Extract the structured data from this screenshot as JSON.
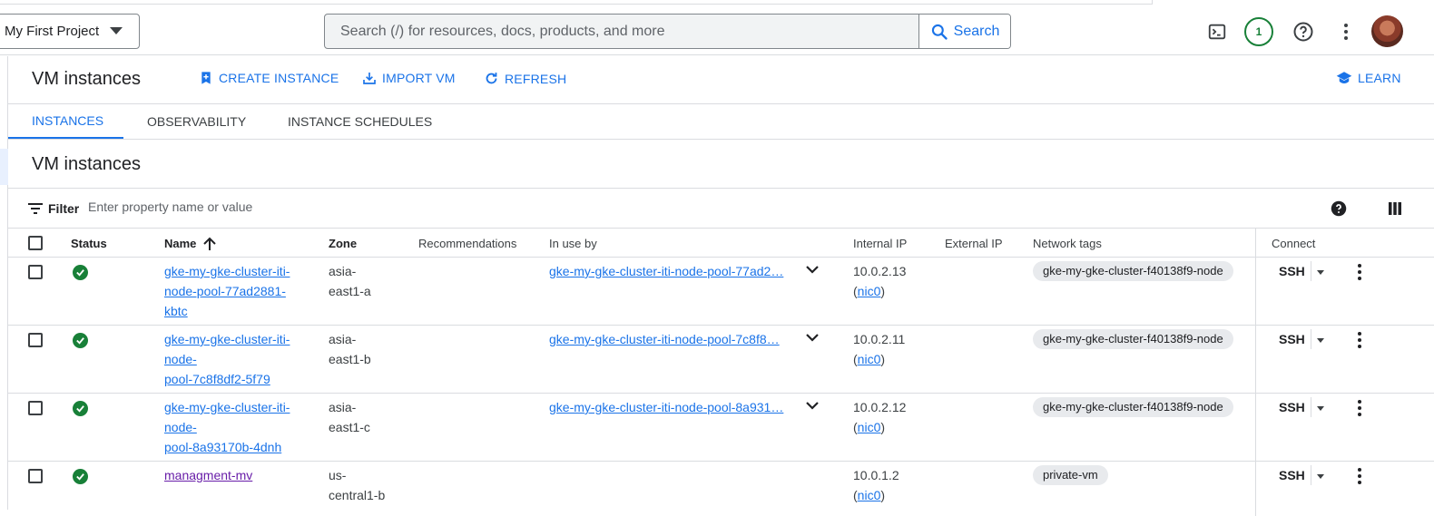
{
  "header": {
    "project": "My First Project",
    "search_placeholder": "Search (/) for resources, docs, products, and more",
    "search_button": "Search",
    "notification_count": "1",
    "icons": [
      "cloud-shell-icon",
      "notification-badge",
      "help-icon",
      "more-vert-icon",
      "avatar"
    ]
  },
  "toolbar": {
    "title": "VM instances",
    "create": "CREATE INSTANCE",
    "import": "IMPORT VM",
    "refresh": "REFRESH",
    "learn": "LEARN"
  },
  "tabs": [
    {
      "label": "INSTANCES",
      "active": true
    },
    {
      "label": "OBSERVABILITY",
      "active": false
    },
    {
      "label": "INSTANCE SCHEDULES",
      "active": false
    }
  ],
  "section_title": "VM instances",
  "filter": {
    "label": "Filter",
    "placeholder": "Enter property name or value"
  },
  "columns": {
    "status": "Status",
    "name": "Name",
    "zone": "Zone",
    "recommendations": "Recommendations",
    "in_use_by": "In use by",
    "internal_ip": "Internal IP",
    "external_ip": "External IP",
    "network_tags": "Network tags",
    "connect": "Connect"
  },
  "rows": [
    {
      "name_lines": [
        "gke-my-gke-cluster-iti-",
        "node-pool-77ad2881-",
        "kbtc"
      ],
      "zone_lines": [
        "asia-",
        "east1-a"
      ],
      "in_use_by": "gke-my-gke-cluster-iti-node-pool-77ad2…",
      "internal_ip": "10.0.2.13",
      "nic": "nic0",
      "tag": "gke-my-gke-cluster-f40138f9-node",
      "connect": "SSH",
      "status": "running"
    },
    {
      "name_lines": [
        "gke-my-gke-cluster-iti-",
        "node-",
        "pool-7c8f8df2-5f79"
      ],
      "zone_lines": [
        "asia-",
        "east1-b"
      ],
      "in_use_by": "gke-my-gke-cluster-iti-node-pool-7c8f8…",
      "internal_ip": "10.0.2.11",
      "nic": "nic0",
      "tag": "gke-my-gke-cluster-f40138f9-node",
      "connect": "SSH",
      "status": "running"
    },
    {
      "name_lines": [
        "gke-my-gke-cluster-iti-",
        "node-",
        "pool-8a93170b-4dnh"
      ],
      "zone_lines": [
        "asia-",
        "east1-c"
      ],
      "in_use_by": "gke-my-gke-cluster-iti-node-pool-8a931…",
      "internal_ip": "10.0.2.12",
      "nic": "nic0",
      "tag": "gke-my-gke-cluster-f40138f9-node",
      "connect": "SSH",
      "status": "running"
    },
    {
      "name_lines": [
        "managment-mv"
      ],
      "zone_lines": [
        "us-",
        "central1-b"
      ],
      "in_use_by": "",
      "internal_ip": "10.0.1.2",
      "nic": "nic0",
      "tag": "private-vm",
      "connect": "SSH",
      "status": "running"
    }
  ]
}
